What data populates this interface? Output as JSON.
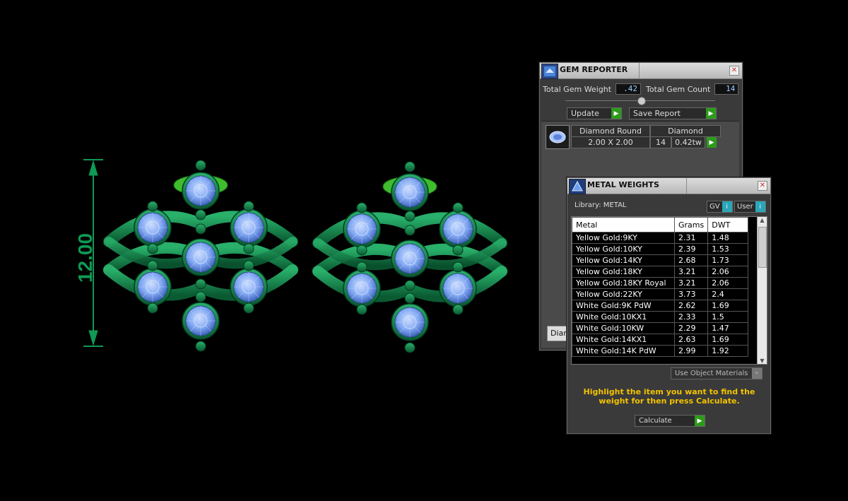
{
  "dimension_label": "12.00",
  "gem_reporter": {
    "title": "GEM REPORTER",
    "close_glyph": "✕",
    "total_gem_weight_label": "Total Gem Weight",
    "total_gem_weight_value": ".42",
    "total_gem_count_label": "Total Gem Count",
    "total_gem_count_value": "14",
    "update_label": "Update",
    "save_report_label": "Save Report",
    "gem_header_shape": "Diamond Round",
    "gem_header_type": "Diamond",
    "gem_size": "2.00 X 2.00",
    "gem_count": "14",
    "gem_weight": "0.42tw",
    "bottom_button_partial": "Diam"
  },
  "metal_weights": {
    "title": "METAL WEIGHTS",
    "close_glyph": "✕",
    "library_label": "Library: METAL",
    "gv_label": "GV",
    "user_label": "User",
    "columns": [
      "Metal",
      "Grams",
      "DWT"
    ],
    "rows": [
      [
        "Yellow Gold:9KY",
        "2.31",
        "1.48"
      ],
      [
        "Yellow Gold:10KY",
        "2.39",
        "1.53"
      ],
      [
        "Yellow Gold:14KY",
        "2.68",
        "1.73"
      ],
      [
        "Yellow Gold:18KY",
        "3.21",
        "2.06"
      ],
      [
        "Yellow Gold:18KY Royal",
        "3.21",
        "2.06"
      ],
      [
        "Yellow Gold:22KY",
        "3.73",
        "2.4"
      ],
      [
        "White Gold:9K PdW",
        "2.62",
        "1.69"
      ],
      [
        "White Gold:10KX1",
        "2.33",
        "1.5"
      ],
      [
        "White Gold:10KW",
        "2.29",
        "1.47"
      ],
      [
        "White Gold:14KX1",
        "2.63",
        "1.69"
      ],
      [
        "White Gold:14K PdW",
        "2.99",
        "1.92"
      ]
    ],
    "use_object_materials_label": "Use Object Materials",
    "instruction": "Highlight the item you want to find the weight for then press Calculate.",
    "calculate_label": "Calculate"
  },
  "colors": {
    "metal_green": "#0f7a45",
    "gem_blue": "#7fa6f2",
    "instruction_yellow": "#f2c200",
    "go_green": "#2e9a1c"
  }
}
